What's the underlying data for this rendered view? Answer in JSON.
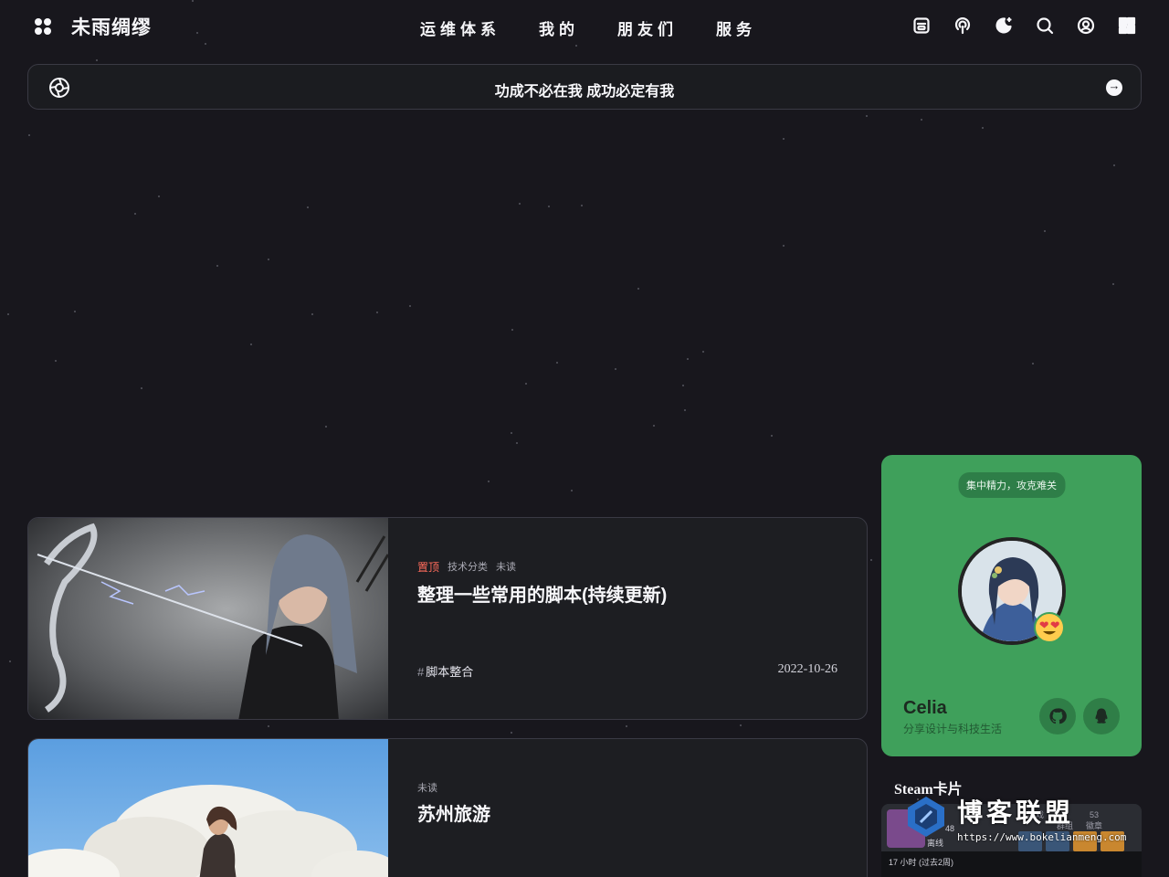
{
  "site": {
    "title": "未雨绸缪"
  },
  "nav": {
    "menu": [
      {
        "label": "运维体系"
      },
      {
        "label": "我的"
      },
      {
        "label": "朋友们"
      },
      {
        "label": "服务"
      }
    ],
    "icons": [
      "article-icon",
      "podcast-icon",
      "dark-mode-icon",
      "search-icon",
      "user-icon",
      "grid-icon"
    ]
  },
  "announcement": {
    "text": "功成不必在我 成功必定有我"
  },
  "posts": [
    {
      "sticky_label": "置顶",
      "category": "技术分类",
      "read_status": "未读",
      "title": "整理一些常用的脚本(持续更新)",
      "tag": "脚本整合",
      "date": "2022-10-26"
    },
    {
      "read_status": "未读",
      "title": "苏州旅游"
    }
  ],
  "profile": {
    "motto": "集中精力，攻克难关",
    "name": "Celia",
    "description": "分享设计与科技生活",
    "accent_color": "#3fa05b"
  },
  "steam": {
    "title": "Steam卡片",
    "level": "48",
    "status": "离线",
    "stats": [
      {
        "value": "",
        "label": "游戏"
      },
      {
        "value": "4",
        "label": "群组"
      },
      {
        "value": "53",
        "label": "徽章"
      }
    ],
    "recent": "17 小时 (过去2周)"
  },
  "watermark": {
    "name": "博客联盟",
    "url": "https://www.bokelianmeng.com"
  }
}
